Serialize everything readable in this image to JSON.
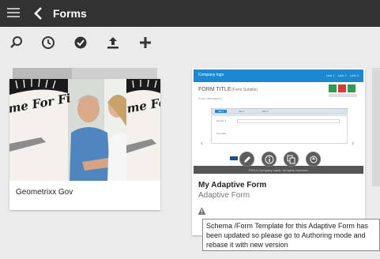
{
  "header": {
    "title": "Forms"
  },
  "toolbar": {
    "icons": [
      "search-icon",
      "clock-icon",
      "check-circle-icon",
      "upload-icon",
      "plus-icon"
    ]
  },
  "cards": [
    {
      "title": "Geometrixx Gov",
      "thumbnail_text": "me For Fi"
    },
    {
      "title": "My Adaptive Form",
      "subtitle": "Adaptive Form",
      "preview": {
        "company_logo": "Company logo",
        "header_links": [
          "Link 1",
          "Link 2",
          "Link 3"
        ],
        "form_title": "FORM TITLE",
        "form_subtitle": "(Form Subtitle)",
        "form_description": "Form description",
        "tabs": [
          "Tab 1",
          "Tab 2",
          "Tab 3"
        ],
        "panel_rows": [
          "Section 1",
          "Text field"
        ],
        "footer": "©2014 Company name. All rights reserved."
      },
      "quick_actions": [
        "edit-icon",
        "info-icon",
        "copy-icon",
        "publish-icon"
      ]
    }
  ],
  "tooltip": {
    "message": "Schema /Form Template for this Adaptive Form has been updated so please go to Authoring mode and rebase it with new version"
  },
  "colors": {
    "topbar": "#323232",
    "accent": "#1c88cf",
    "background": "#ebebeb"
  }
}
